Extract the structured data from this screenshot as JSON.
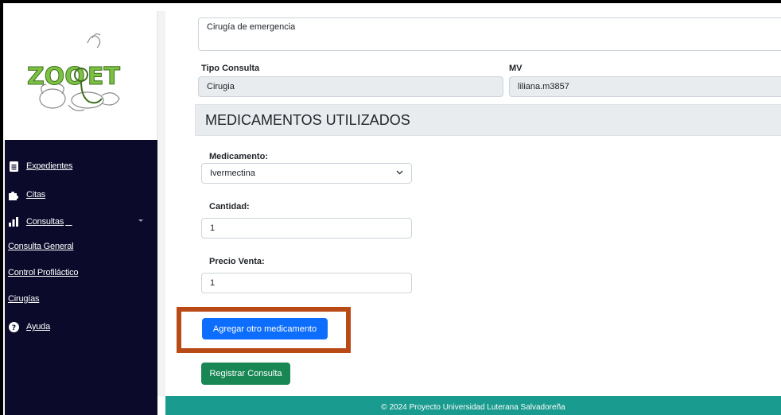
{
  "app": {
    "logo_text": "ZOOPET"
  },
  "sidebar": {
    "items": [
      {
        "label": "Expedientes",
        "icon": "file-icon"
      },
      {
        "label": "Citas",
        "icon": "puzzle-icon"
      },
      {
        "label": "Consultas",
        "icon": "bar-chart-icon"
      },
      {
        "label": "Consulta General"
      },
      {
        "label": "Control Profiláctico"
      },
      {
        "label": "Cirugías"
      },
      {
        "label": "Ayuda",
        "icon": "question-circle-icon"
      }
    ]
  },
  "form": {
    "description_value": "Cirugía de emergencia",
    "tipo_consulta_label": "Tipo Consulta",
    "tipo_consulta_value": "Cirugia",
    "mv_label": "MV",
    "mv_value": "liliana.m3857"
  },
  "medicamentos": {
    "section_title": "MEDICAMENTOS UTILIZADOS",
    "medicamento_label": "Medicamento:",
    "medicamento_value": "Ivermectina",
    "cantidad_label": "Cantidad:",
    "cantidad_value": "1",
    "precio_label": "Precio Venta:",
    "precio_value": "1",
    "add_button": "Agregar otro medicamento",
    "submit_button": "Registrar Consulta"
  },
  "footer": {
    "text": "© 2024 Proyecto Universidad Luterana Salvadoreña"
  },
  "colors": {
    "sidebar_bg": "#0b0a2b",
    "primary": "#0d6efd",
    "success": "#198754",
    "footer_bg": "#1a9b8f",
    "highlight": "#b94a16"
  }
}
